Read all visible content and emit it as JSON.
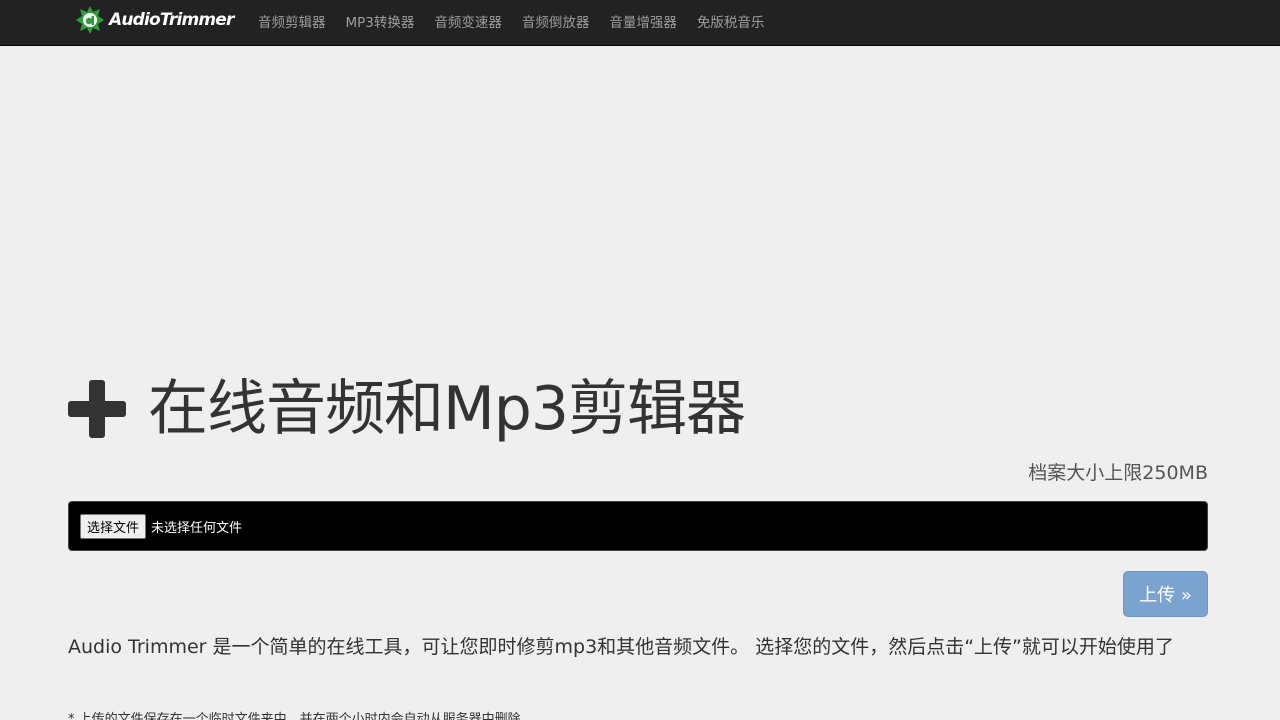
{
  "header": {
    "brand": "AudioTrimmer",
    "nav": [
      {
        "label": "音频剪辑器"
      },
      {
        "label": "MP3转换器"
      },
      {
        "label": "音频变速器"
      },
      {
        "label": "音频倒放器"
      },
      {
        "label": "音量增强器"
      },
      {
        "label": "免版税音乐"
      }
    ]
  },
  "main": {
    "title": "在线音频和Mp3剪辑器",
    "size_limit": "档案大小上限250MB",
    "file_input": {
      "button_label": "选择文件",
      "status": "未选择任何文件"
    },
    "upload_button": "上传 »",
    "description": "Audio Trimmer 是一个简单的在线工具，可让您即时修剪mp3和其他音频文件。 选择您的文件，然后点击“上传”就可以开始使用了",
    "note": "* 上传的文件保存在一个临时文件夹中，并在两个小时内会自动从服务器中删除。"
  },
  "icons": {
    "logo": "audiotrimmer-logo-icon",
    "hero": "plus-icon"
  },
  "colors": {
    "navbar": "#222222",
    "background": "#efefef",
    "accent": "#7aa3cf",
    "logo_green": "#2e9e3b"
  }
}
